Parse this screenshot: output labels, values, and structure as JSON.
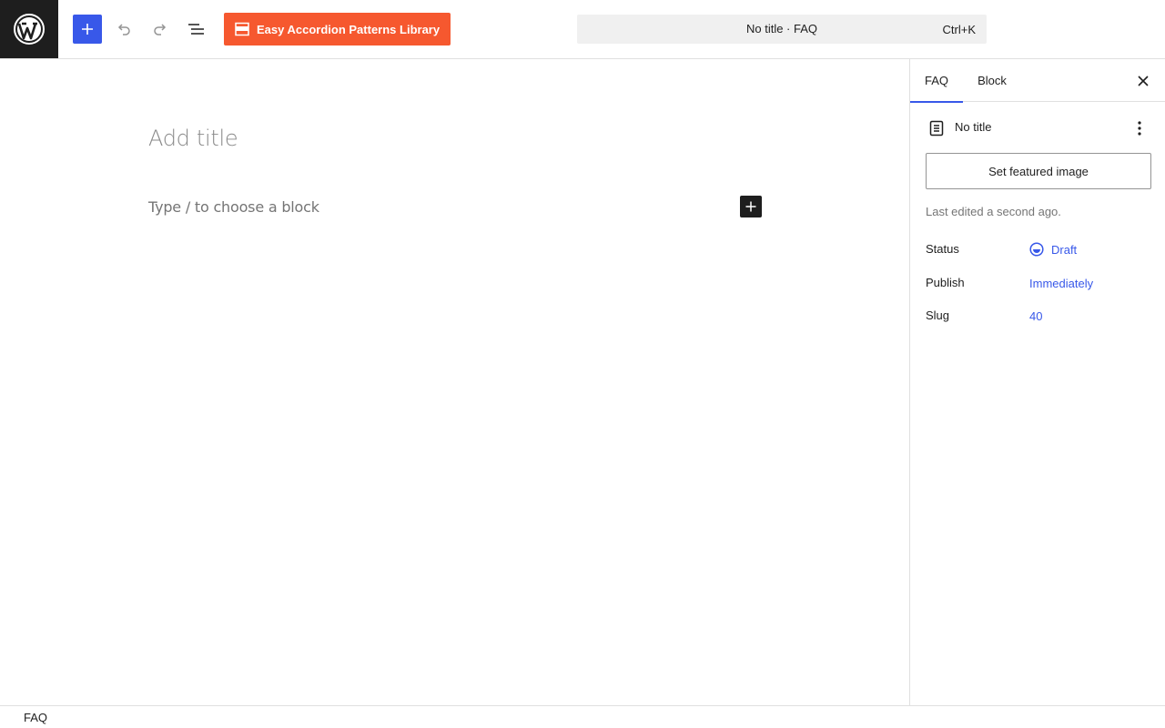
{
  "header": {
    "logo_icon": "wordpress-logo-icon",
    "inserter_icon": "plus-icon",
    "undo_icon": "undo-icon",
    "redo_icon": "redo-icon",
    "list_view_icon": "list-view-icon",
    "plugin_button_label": "Easy Accordion Patterns Library",
    "plugin_button_color": "#f6582f",
    "command_bar": {
      "title": "No title · FAQ",
      "shortcut": "Ctrl+K"
    }
  },
  "editor": {
    "title_placeholder": "Add title",
    "block_placeholder": "Type / to choose a block"
  },
  "sidebar": {
    "tabs": [
      {
        "label": "FAQ",
        "active": true
      },
      {
        "label": "Block",
        "active": false
      }
    ],
    "post_title": "No title",
    "featured_image_button": "Set featured image",
    "last_edited": "Last edited a second ago.",
    "rows": {
      "status": {
        "label": "Status",
        "value": "Draft"
      },
      "publish": {
        "label": "Publish",
        "value": "Immediately"
      },
      "slug": {
        "label": "Slug",
        "value": "40"
      }
    }
  },
  "footer": {
    "breadcrumb": "FAQ"
  },
  "colors": {
    "accent": "#3858e9",
    "dark": "#1e1e1e"
  }
}
